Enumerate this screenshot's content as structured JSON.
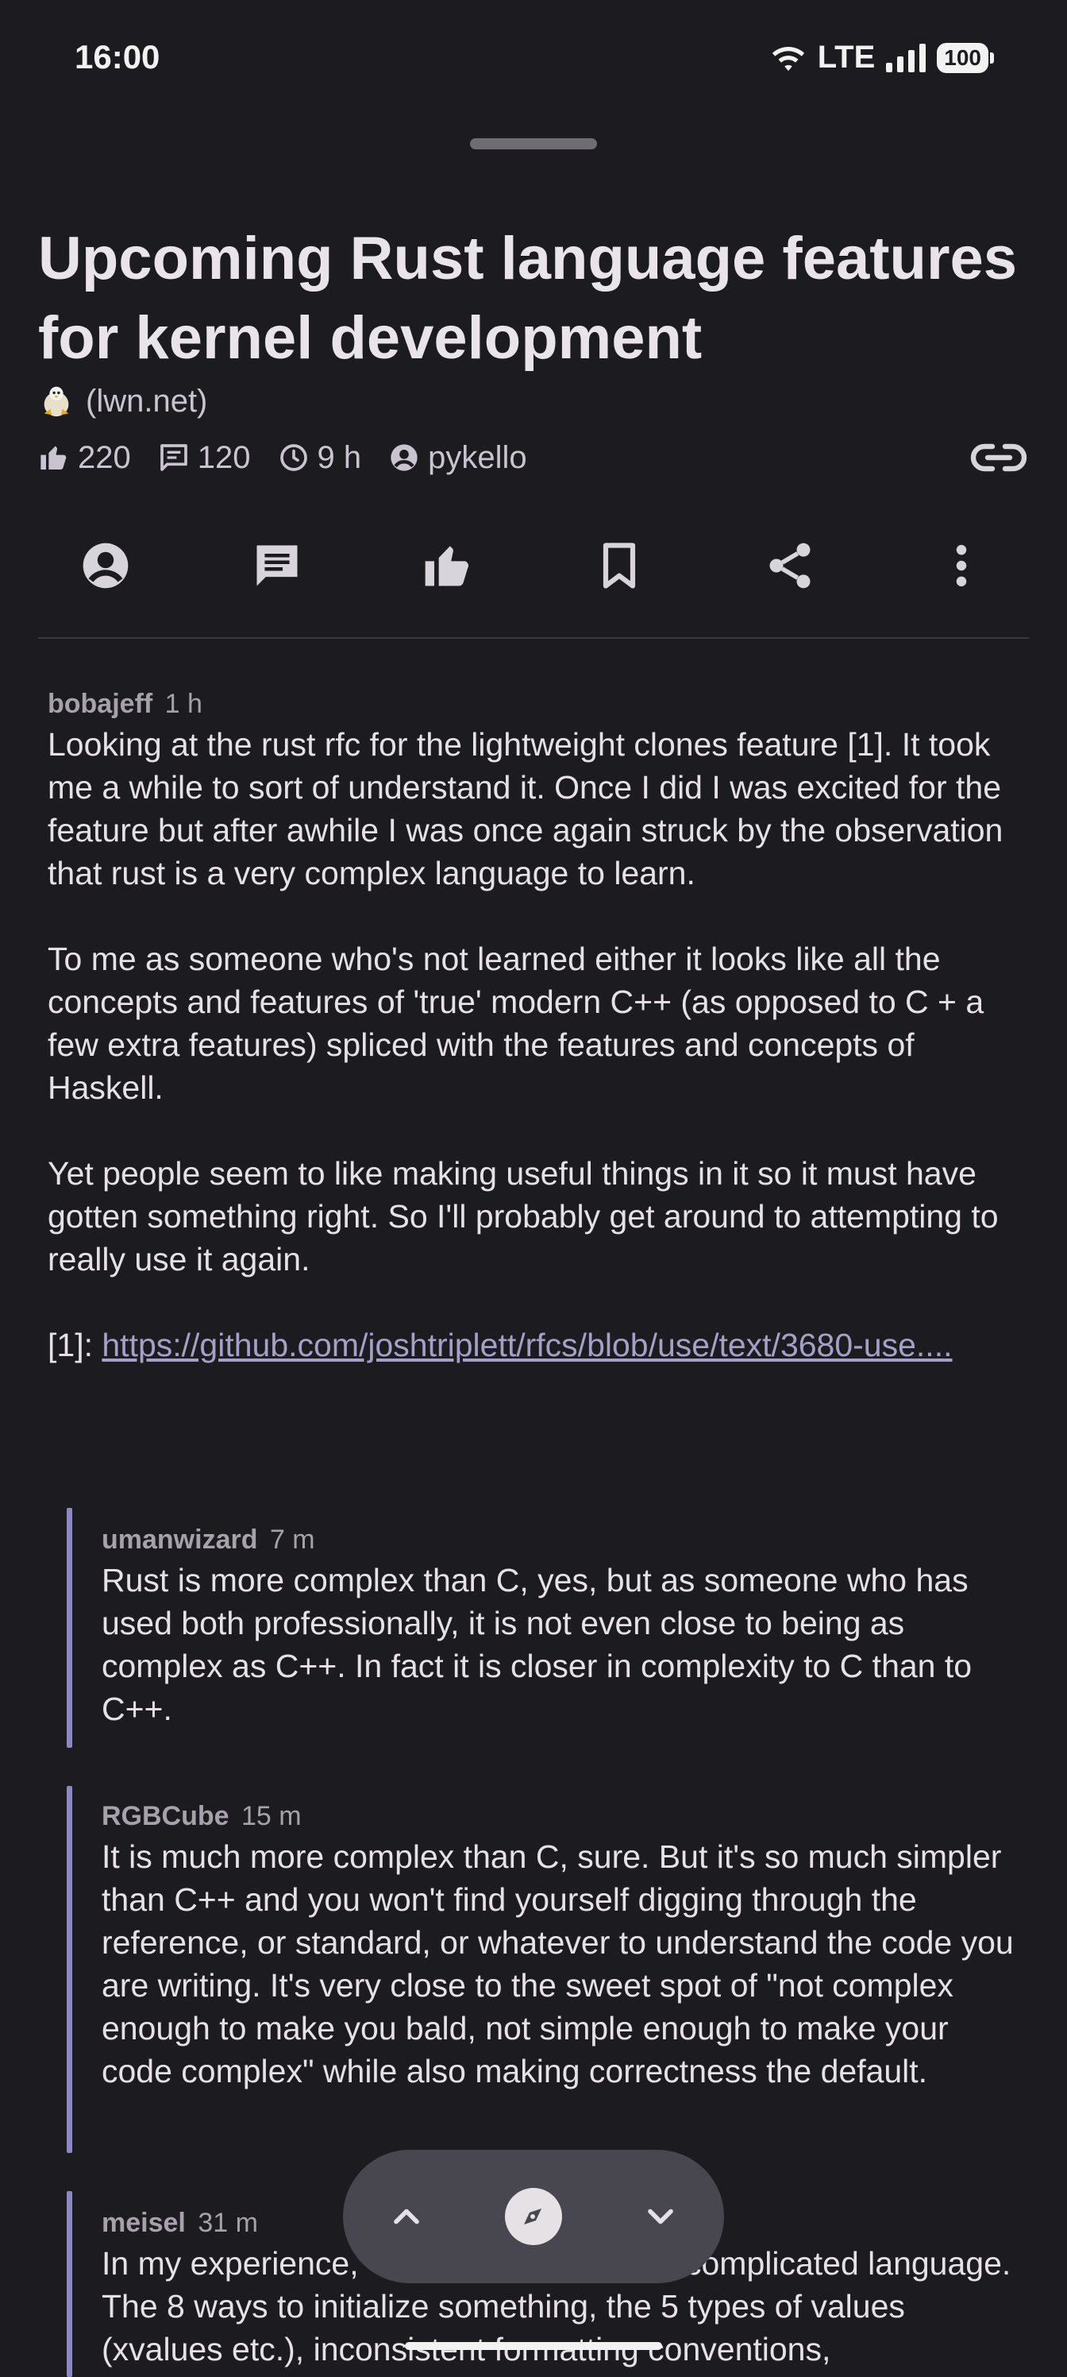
{
  "status_bar": {
    "time": "16:00",
    "network": "LTE",
    "battery": "100"
  },
  "post": {
    "title": "Upcoming Rust language features for kernel development",
    "domain": "(lwn.net)",
    "upvotes": "220",
    "comments": "120",
    "age": "9 h",
    "author": "pykello"
  },
  "actions": [
    "profile",
    "comments",
    "upvote",
    "bookmark",
    "share",
    "more"
  ],
  "comments": [
    {
      "author": "bobajeff",
      "time": "1 h",
      "paragraphs": [
        "Looking at the rust rfc for the lightweight clones feature [1]. It took me a while to sort of understand it. Once I did I was excited for the feature but after awhile I was once again struck by the observation that rust is a very complex language to learn.",
        "To me as someone who's not learned either it looks like all the concepts and features of 'true' modern C++ (as opposed to C + a few extra features) spliced with the features and concepts of Haskell.",
        "Yet people seem to like making useful things in it so it must have gotten something right. So I'll probably get around to attempting to really use it again."
      ],
      "ref_label": "[1]: ",
      "ref_link": "https://github.com/joshtriplett/rfcs/blob/use/text/3680-use...."
    },
    {
      "author": "umanwizard",
      "time": "7 m",
      "text": "Rust is more complex than C, yes, but as someone who has used both professionally, it is not even close to being as complex as C++. In fact it is closer in complexity to C than to C++."
    },
    {
      "author": "RGBCube",
      "time": "15 m",
      "text": "It is much more complex than C, sure. But it's so much simpler than C++ and you won't find yourself digging through the reference, or standard, or whatever to understand the code you are writing. It's very close to the sweet spot of \"not complex enough to make you bald, not simple enough to make your code complex\" while also making correctness the default."
    },
    {
      "author": "meisel",
      "time": "31 m",
      "text_before": "In my experience, ",
      "text_after": "complicated language. The 8 ways to initialize something, the 5 types of values (xvalues etc.), inconsistent formatting conventions,"
    }
  ],
  "nav": {
    "prev": "previous-comment",
    "center": "navigate",
    "next": "next-comment"
  },
  "colors": {
    "background": "#1c1b1f",
    "accent_bar": "#8d88c0",
    "link": "#a5a0c8"
  }
}
